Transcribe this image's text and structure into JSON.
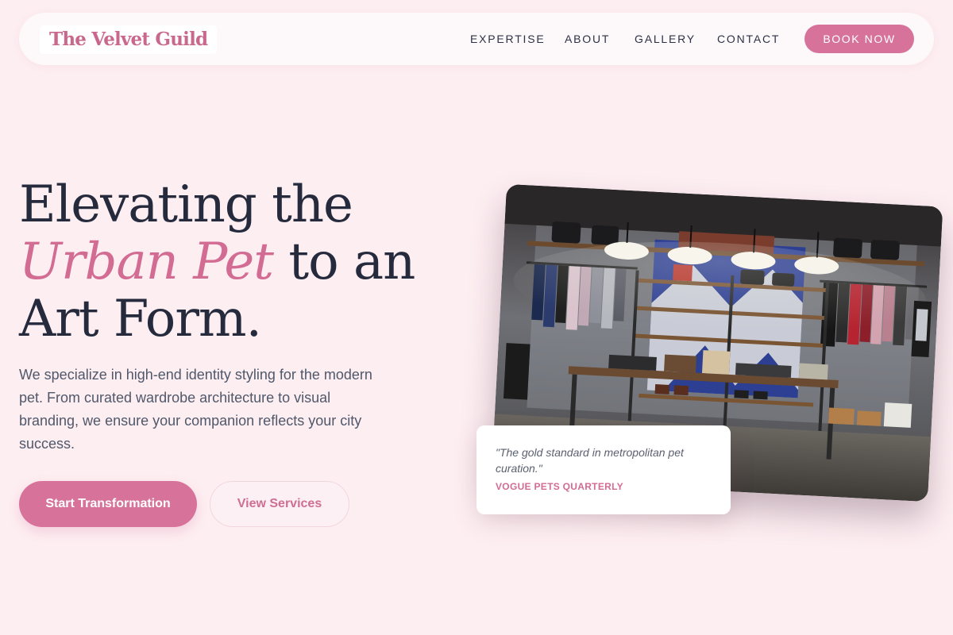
{
  "brand": {
    "logo_text": "The Velvet Guild"
  },
  "nav": {
    "links": [
      "EXPERTISE",
      "ABOUT",
      "GALLERY",
      "CONTACT"
    ],
    "cta_label": "BOOK NOW"
  },
  "hero": {
    "headline_line1": "Elevating the",
    "headline_accent": "Urban Pet",
    "headline_line2_rest": "to an",
    "headline_line3": "Art Form.",
    "description": "We specialize in high-end identity styling for the modern pet. From curated wardrobe architecture to visual branding, we ensure your companion reflects your city success.",
    "primary_button": "Start Transformation",
    "secondary_button": "View Services"
  },
  "testimonial": {
    "quote": "\"The gold standard in metropolitan pet curation.\"",
    "source": "VOGUE PETS QUARTERLY"
  },
  "colors": {
    "background": "#fdeef2",
    "accent": "#d7739a",
    "text": "#252b3c"
  }
}
